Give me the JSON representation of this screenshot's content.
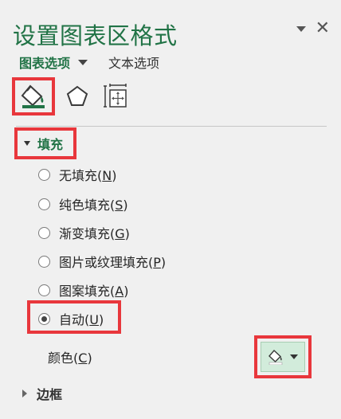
{
  "pane": {
    "title": "设置图表区格式",
    "tabs": {
      "chart_options": "图表选项",
      "text_options": "文本选项"
    }
  },
  "toolbar": {
    "fill_line": "fill-line-icon",
    "effects": "pentagon-effects-icon",
    "size_properties": "size-properties-icon"
  },
  "fill": {
    "label": "填充",
    "expanded": true,
    "options": [
      {
        "label": "无填充",
        "key": "N",
        "checked": false
      },
      {
        "label": "纯色填充",
        "key": "S",
        "checked": false
      },
      {
        "label": "渐变填充",
        "key": "G",
        "checked": false
      },
      {
        "label": "图片或纹理填充",
        "key": "P",
        "checked": false
      },
      {
        "label": "图案填充",
        "key": "A",
        "checked": false
      },
      {
        "label": "自动",
        "key": "U",
        "checked": true
      }
    ],
    "color": {
      "label": "颜色",
      "key": "C"
    }
  },
  "border": {
    "label": "边框",
    "expanded": false
  },
  "colors": {
    "accent": "#217346",
    "highlight": "#e8373c",
    "color_button_bg": "#d2ecdb"
  }
}
